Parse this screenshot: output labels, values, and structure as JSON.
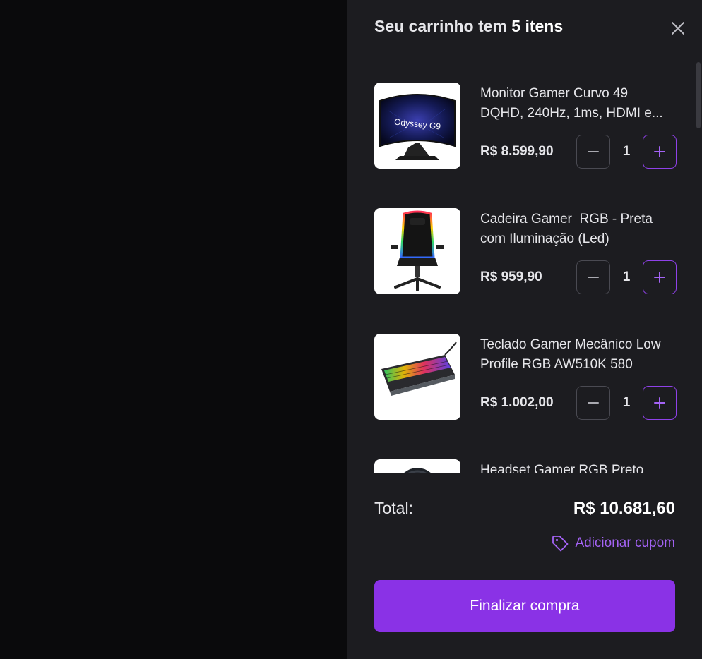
{
  "cart": {
    "title_prefix": "Seu carrinho tem ",
    "title_count": "5 itens",
    "items": [
      {
        "name_line1": "Monitor Gamer Curvo 49",
        "name_line2": "DQHD, 240Hz, 1ms, HDMI e...",
        "price": "R$ 8.599,90",
        "quantity": "1",
        "image_brand": "Odyssey G9"
      },
      {
        "name_line1": "Cadeira Gamer  RGB - Preta",
        "name_line2": "com Iluminação (Led)",
        "price": "R$ 959,90",
        "quantity": "1"
      },
      {
        "name_line1": "Teclado Gamer Mecânico Low",
        "name_line2": "Profile RGB AW510K 580",
        "price": "R$ 1.002,00",
        "quantity": "1"
      },
      {
        "name_line1": "Headset Gamer RGB Preto"
      }
    ]
  },
  "footer": {
    "total_label": "Total:",
    "total_value": "R$ 10.681,60",
    "coupon_label": "Adicionar cupom",
    "checkout_label": "Finalizar compra"
  },
  "colors": {
    "accent": "#8a32e6",
    "accent_text": "#a463f5",
    "drawer_bg": "#1c1c20",
    "overlay_bg": "#0a0a0c"
  }
}
